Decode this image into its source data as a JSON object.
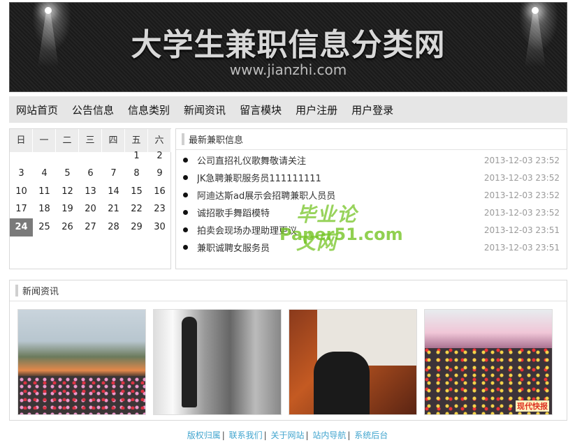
{
  "banner": {
    "title": "大学生兼职信息分类网",
    "url": "www.jianzhi.com"
  },
  "nav": {
    "items": [
      {
        "label": "网站首页"
      },
      {
        "label": "公告信息"
      },
      {
        "label": "信息类别"
      },
      {
        "label": "新闻资讯"
      },
      {
        "label": "留言模块"
      },
      {
        "label": "用户注册"
      },
      {
        "label": "用户登录"
      }
    ]
  },
  "calendar": {
    "weekdays": [
      "日",
      "一",
      "二",
      "三",
      "四",
      "五",
      "六"
    ],
    "weeks": [
      [
        "",
        "",
        "",
        "",
        "",
        "1",
        "2"
      ],
      [
        "3",
        "4",
        "5",
        "6",
        "7",
        "8",
        "9"
      ],
      [
        "10",
        "11",
        "12",
        "13",
        "14",
        "15",
        "16"
      ],
      [
        "17",
        "18",
        "19",
        "20",
        "21",
        "22",
        "23"
      ],
      [
        "24",
        "25",
        "26",
        "27",
        "28",
        "29",
        "30"
      ]
    ],
    "today": "24"
  },
  "jobs": {
    "title": "最新兼职信息",
    "items": [
      {
        "title": "公司直招礼仪歌舞敬请关注",
        "date": "2013-12-03 23:52"
      },
      {
        "title": "JK急聘兼职服务员111111111",
        "date": "2013-12-03 23:52"
      },
      {
        "title": "阿迪达斯ad展示会招聘兼职人员员",
        "date": "2013-12-03 23:52"
      },
      {
        "title": "诚招歌手舞蹈模特",
        "date": "2013-12-03 23:52"
      },
      {
        "title": "拍卖会现场办理助理更议",
        "date": "2013-12-03 23:51"
      },
      {
        "title": "兼职诚聘女服务员",
        "date": "2013-12-03 23:51"
      }
    ]
  },
  "watermark": {
    "top": "毕业论文网",
    "bottom": "Paper51.com"
  },
  "news": {
    "title": "新闻资讯",
    "photo_stamp": "现代快报"
  },
  "footer": {
    "links": [
      {
        "label": "版权归属"
      },
      {
        "label": "联系我们"
      },
      {
        "label": "关于网站"
      },
      {
        "label": "站内导航"
      },
      {
        "label": "系统后台"
      }
    ]
  }
}
